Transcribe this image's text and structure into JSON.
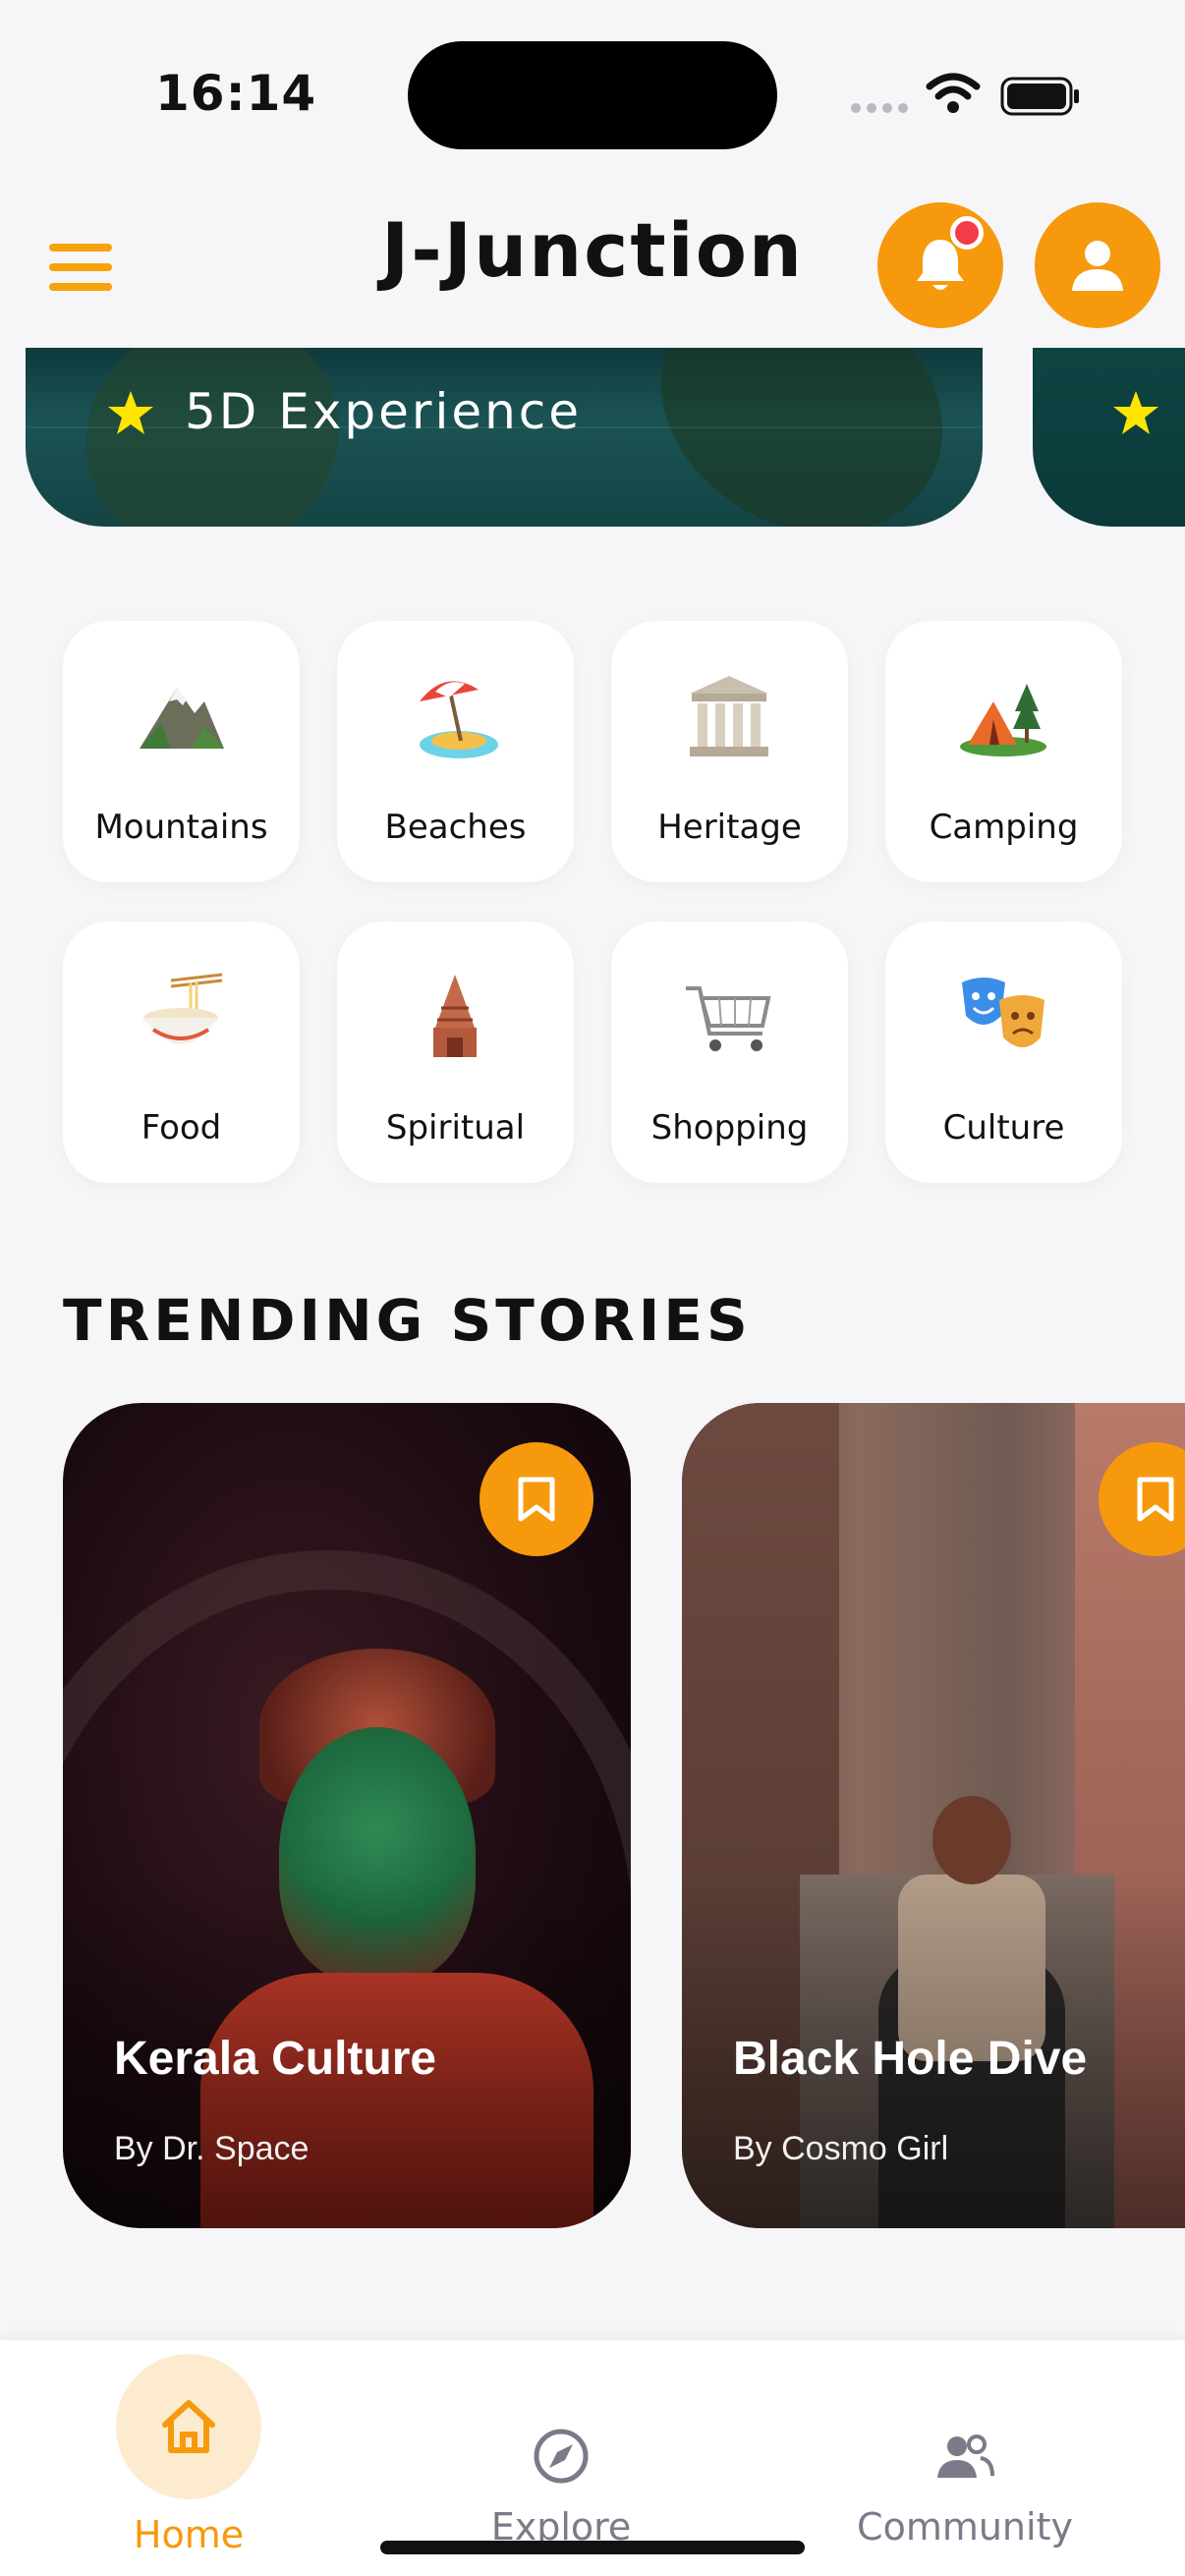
{
  "status_bar": {
    "time": "16:14"
  },
  "header": {
    "title": "J-Junction"
  },
  "banners": [
    {
      "label": "5D Experience"
    }
  ],
  "categories": [
    {
      "label": "Mountains"
    },
    {
      "label": "Beaches"
    },
    {
      "label": "Heritage"
    },
    {
      "label": "Camping"
    },
    {
      "label": "Food"
    },
    {
      "label": "Spiritual"
    },
    {
      "label": "Shopping"
    },
    {
      "label": "Culture"
    }
  ],
  "trending": {
    "title": "TRENDING STORIES",
    "stories": [
      {
        "title": "Kerala Culture",
        "author": "By Dr. Space"
      },
      {
        "title": "Black Hole Dive",
        "author": "By Cosmo Girl"
      }
    ]
  },
  "bottom_nav": {
    "items": [
      {
        "label": "Home",
        "icon": "home-icon",
        "active": true
      },
      {
        "label": "Explore",
        "icon": "compass-icon",
        "active": false
      },
      {
        "label": "Community",
        "icon": "people-icon",
        "active": false
      }
    ]
  },
  "colors": {
    "accent": "#F7990C",
    "background": "#F6F6F8",
    "notification_dot": "#F23B4B"
  }
}
